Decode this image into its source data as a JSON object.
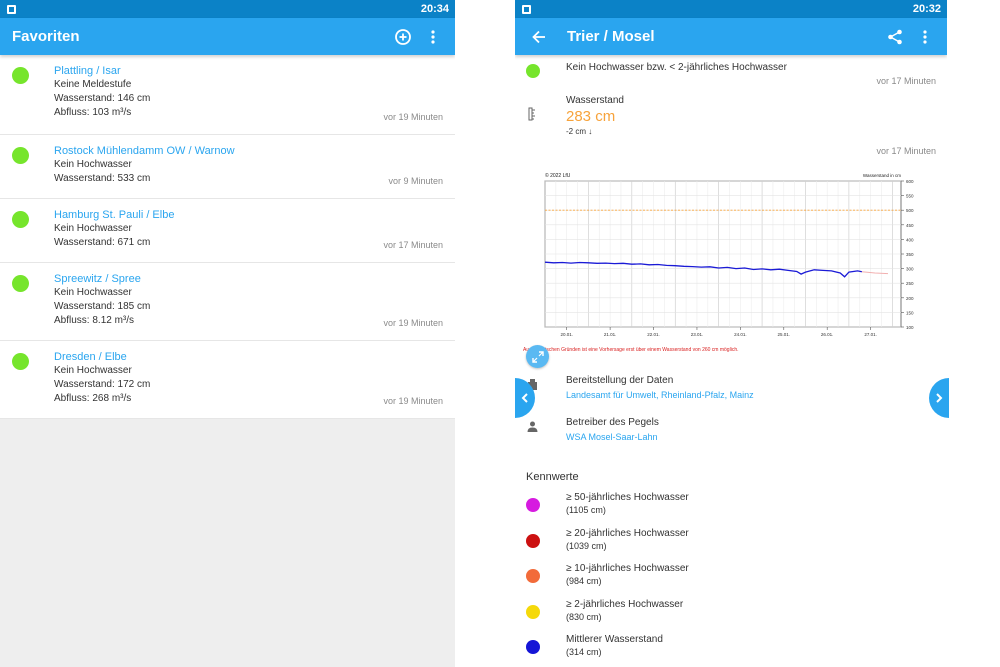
{
  "left": {
    "status_time": "20:34",
    "title": "Favoriten",
    "items": [
      {
        "name": "Plattling / Isar",
        "lines": [
          "Keine Meldestufe",
          "Wasserstand: 146 cm",
          "Abfluss: 103 m³/s"
        ],
        "ago": "vor 19 Minuten",
        "color": "#76e52c"
      },
      {
        "name": "Rostock Mühlendamm OW / Warnow",
        "lines": [
          "Kein Hochwasser",
          "Wasserstand: 533 cm"
        ],
        "ago": "vor 9 Minuten",
        "color": "#76e52c"
      },
      {
        "name": "Hamburg St. Pauli / Elbe",
        "lines": [
          "Kein Hochwasser",
          "Wasserstand: 671 cm"
        ],
        "ago": "vor 17 Minuten",
        "color": "#76e52c"
      },
      {
        "name": "Spreewitz / Spree",
        "lines": [
          "Kein Hochwasser",
          "Wasserstand: 185 cm",
          "Abfluss: 8.12 m³/s"
        ],
        "ago": "vor 19 Minuten",
        "color": "#76e52c"
      },
      {
        "name": "Dresden / Elbe",
        "lines": [
          "Kein Hochwasser",
          "Wasserstand: 172 cm",
          "Abfluss: 268 m³/s"
        ],
        "ago": "vor 19 Minuten",
        "color": "#76e52c"
      }
    ]
  },
  "right": {
    "status_time": "20:32",
    "title": "Trier / Mosel",
    "status_text": "Kein Hochwasser bzw. < 2-jährliches Hochwasser",
    "status_ago": "vor 17 Minuten",
    "waterlevel": {
      "label": "Wasserstand",
      "value": "283 cm",
      "change": "-2 cm ↓",
      "ago": "vor 17 Minuten"
    },
    "chart_note": "Aus technischen Gründen ist eine Vorhersage erst über einem Wasserstand von 260 cm möglich.",
    "provider": {
      "label": "Bereitstellung der Daten",
      "link": "Landesamt für Umwelt, Rheinland-Pfalz, Mainz"
    },
    "operator": {
      "label": "Betreiber des Pegels",
      "link": "WSA Mosel-Saar-Lahn"
    },
    "kennwerte_title": "Kennwerte",
    "kennwerte": [
      {
        "label": "≥ 50-jährliches Hochwasser",
        "value": "(1105 cm)",
        "color": "#d61be0"
      },
      {
        "label": "≥ 20-jährliches Hochwasser",
        "value": "(1039 cm)",
        "color": "#cc1111"
      },
      {
        "label": "≥ 10-jährliches Hochwasser",
        "value": "(984 cm)",
        "color": "#f26b3a"
      },
      {
        "label": "≥ 2-jährliches Hochwasser",
        "value": "(830 cm)",
        "color": "#f5d90a"
      },
      {
        "label": "Mittlerer Wasserstand",
        "value": "(314 cm)",
        "color": "#1515d6"
      }
    ]
  },
  "chart_data": {
    "type": "line",
    "title": "Wasserstand in cm",
    "copyright": "© 2022 LfU",
    "categories": [
      "20.01.",
      "21.01.",
      "22.01.",
      "23.01.",
      "24.01.",
      "25.01.",
      "26.01.",
      "27.01."
    ],
    "yticks": [
      100,
      150,
      200,
      250,
      300,
      350,
      400,
      450,
      500,
      550,
      600
    ],
    "ylim": [
      100,
      600
    ],
    "xlim": [
      0,
      8.2
    ],
    "reference_line": {
      "value": 500,
      "color": "#f7a33b"
    },
    "series": [
      {
        "color": "#1a1ad6",
        "x": [
          0,
          0.2,
          0.4,
          0.6,
          0.8,
          1.0,
          1.2,
          1.4,
          1.6,
          1.8,
          2.0,
          2.2,
          2.4,
          2.6,
          2.8,
          3.0,
          3.2,
          3.4,
          3.6,
          3.8,
          4.0,
          4.2,
          4.4,
          4.6,
          4.8,
          5.0,
          5.2,
          5.4,
          5.6,
          5.8,
          5.9,
          6.0,
          6.2,
          6.4,
          6.6,
          6.8,
          6.9,
          7.0,
          7.2,
          7.3
        ],
        "values": [
          322,
          320,
          321,
          319,
          321,
          320,
          318,
          319,
          317,
          318,
          315,
          316,
          313,
          314,
          311,
          310,
          308,
          307,
          305,
          306,
          302,
          304,
          300,
          302,
          297,
          299,
          296,
          298,
          294,
          290,
          281,
          288,
          296,
          294,
          292,
          285,
          272,
          288,
          292,
          289
        ]
      },
      {
        "color": "#f2b0b0",
        "x": [
          7.3,
          7.6,
          7.9
        ],
        "values": [
          289,
          285,
          283
        ]
      }
    ]
  }
}
